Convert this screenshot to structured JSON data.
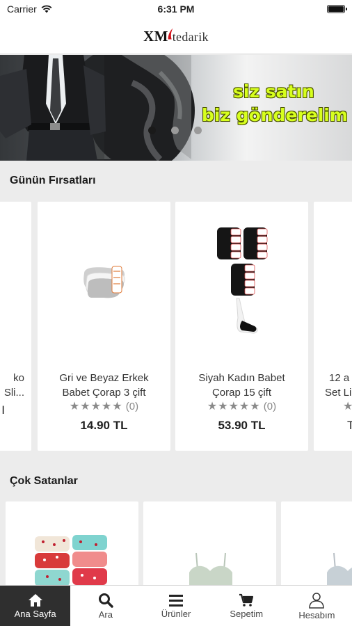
{
  "status_bar": {
    "carrier": "Carrier",
    "time": "6:31 PM",
    "battery_level": 1.0
  },
  "header": {
    "logo_xm": "XM",
    "logo_tedarik": "tedarik"
  },
  "banner": {
    "line1": "siz satın",
    "line2": "biz gönderelim",
    "slide_count": 3,
    "active_slide": 1
  },
  "deals": {
    "title": "Günün Fırsatları",
    "items": [
      {
        "name_line1": "ko",
        "name_line2": "Sli...",
        "rating": "",
        "price": "I"
      },
      {
        "name_line1": "Gri ve Beyaz Erkek",
        "name_line2": "Babet Çorap 3 çift",
        "stars": "★★★★★",
        "rating": "(0)",
        "price": "14.90 TL"
      },
      {
        "name_line1": "Siyah Kadın Babet",
        "name_line2": "Çorap 15 çift",
        "stars": "★★★★★",
        "rating": "(0)",
        "price": "53.90 TL"
      },
      {
        "name_line1": "12 a",
        "name_line2": "Set Li",
        "stars": "★",
        "rating": "",
        "price": "T"
      }
    ]
  },
  "bestsellers": {
    "title": "Çok Satanlar"
  },
  "tabs": [
    {
      "label": "Ana Sayfa",
      "icon": "home-icon",
      "active": true
    },
    {
      "label": "Ara",
      "icon": "search-icon",
      "active": false
    },
    {
      "label": "Ürünler",
      "icon": "menu-icon",
      "active": false
    },
    {
      "label": "Sepetim",
      "icon": "cart-icon",
      "active": false
    },
    {
      "label": "Hesabım",
      "icon": "user-icon",
      "active": false
    }
  ],
  "colors": {
    "banner_text": "#d7ff1e",
    "active_tab": "#2f2f2f",
    "background": "#ececec"
  }
}
